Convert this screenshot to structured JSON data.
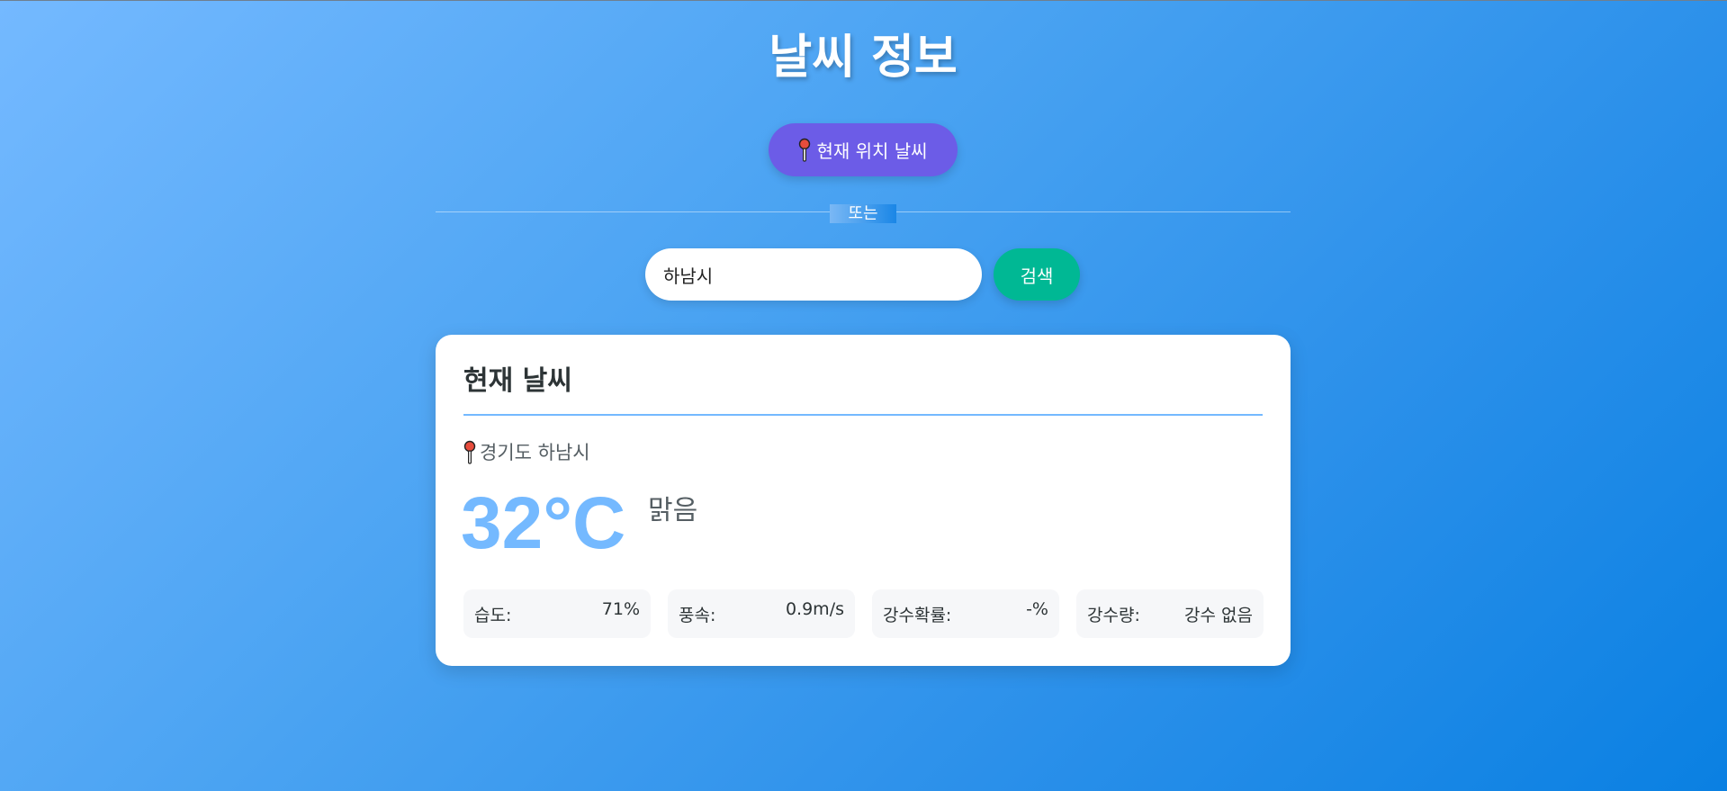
{
  "header": {
    "title": "날씨 정보"
  },
  "location_button": {
    "label": "현재 위치 날씨",
    "icon": "pin-icon"
  },
  "divider": {
    "label": "또는"
  },
  "search": {
    "value": "하남시",
    "button_label": "검색"
  },
  "weather_card": {
    "title": "현재 날씨",
    "location": "경기도 하남시",
    "temperature": "32°C",
    "condition": "맑음",
    "stats": [
      {
        "label": "습도:",
        "value": "71%"
      },
      {
        "label": "풍속:",
        "value": "0.9m/s"
      },
      {
        "label": "강수확률:",
        "value": "-%"
      },
      {
        "label": "강수량:",
        "value": "강수 없음"
      }
    ]
  },
  "colors": {
    "location_button": "#6c5ce7",
    "search_button": "#00b894",
    "temperature": "#74b9ff",
    "accent_rule": "#74b9ff"
  }
}
